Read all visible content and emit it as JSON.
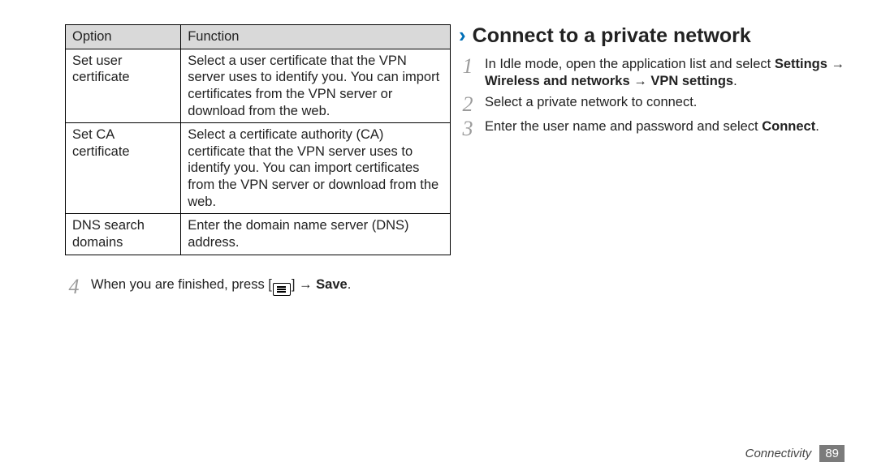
{
  "left": {
    "table": {
      "head": {
        "opt": "Option",
        "fun": "Function"
      },
      "rows": [
        {
          "opt": "Set user certificate",
          "fun": "Select a user certificate that the VPN server uses to identify you. You can import certificates from the VPN server or download from the web."
        },
        {
          "opt": "Set CA certificate",
          "fun": "Select a certificate authority (CA) certificate that the VPN server uses to identify you. You can import certificates from the VPN server or download from the web."
        },
        {
          "opt": "DNS search domains",
          "fun": "Enter the domain name server (DNS) address."
        }
      ]
    },
    "step": {
      "num": "4",
      "pre": "When you are finished, press [",
      "post_arrow": "] → ",
      "save": "Save",
      "end": "."
    }
  },
  "right": {
    "heading": "Connect to a private network",
    "steps": {
      "s1": {
        "num": "1",
        "pre": "In Idle mode, open the application list and select ",
        "bold": "Settings → Wireless and networks → VPN settings",
        "end": "."
      },
      "s2": {
        "num": "2",
        "text": "Select a private network to connect."
      },
      "s3": {
        "num": "3",
        "pre": "Enter the user name and password and select ",
        "bold": "Connect",
        "end": "."
      }
    }
  },
  "footer": {
    "section": "Connectivity",
    "page": "89"
  }
}
